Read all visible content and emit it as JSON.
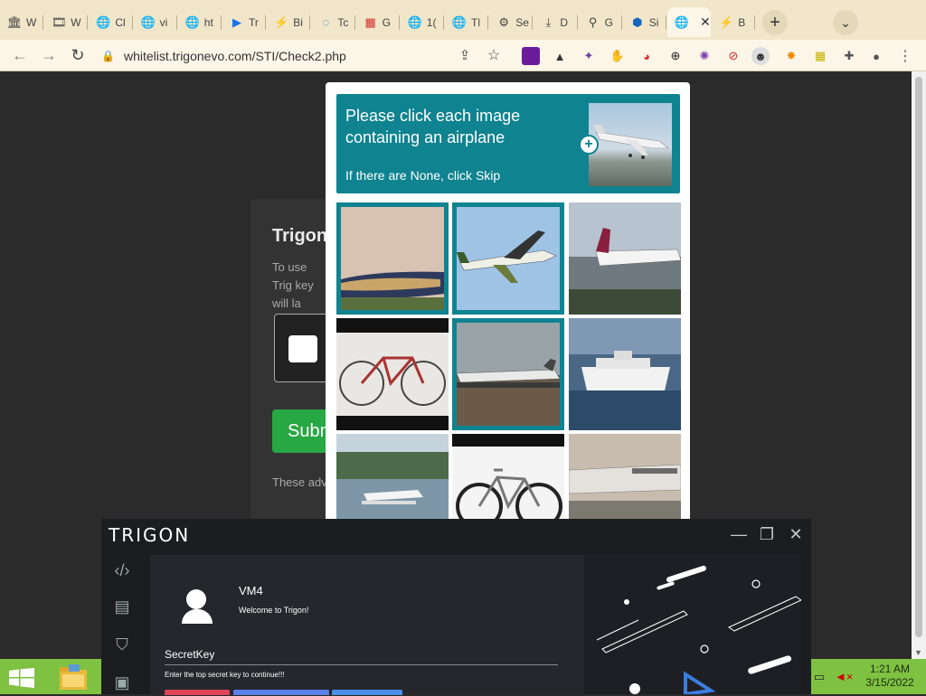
{
  "browser": {
    "tabs": [
      {
        "label": "W",
        "icon": "museum-icon"
      },
      {
        "label": "W",
        "icon": "film-icon"
      },
      {
        "label": "Cl",
        "icon": "globe-icon"
      },
      {
        "label": "vi",
        "icon": "globe-icon"
      },
      {
        "label": "ht",
        "icon": "globe-icon"
      },
      {
        "label": "Tr",
        "icon": "play-icon"
      },
      {
        "label": "Bi",
        "icon": "bolt-icon"
      },
      {
        "label": "Tc",
        "icon": "loading-icon"
      },
      {
        "label": "G",
        "icon": "red-grid-icon"
      },
      {
        "label": "1(",
        "icon": "globe-icon"
      },
      {
        "label": "Tl",
        "icon": "globe-icon"
      },
      {
        "label": "Se",
        "icon": "gear-icon"
      },
      {
        "label": "D",
        "icon": "download-icon"
      },
      {
        "label": "G",
        "icon": "pin-icon"
      },
      {
        "label": "Si",
        "icon": "cube-icon"
      },
      {
        "label": "",
        "icon": "globe-icon"
      },
      {
        "label": "B",
        "icon": "bolt-icon"
      }
    ],
    "new_tab": "+",
    "tab_search": "⌄",
    "url": "whitelist.trigonevo.com/STI/Check2.php"
  },
  "page": {
    "title": "Trigon",
    "desc": "To use Trig key will la",
    "submit": "Subm",
    "footer": "These adv"
  },
  "captcha": {
    "prompt": "Please click each image containing an airplane",
    "hint": "If there are None, click Skip",
    "accent": "#0f8390"
  },
  "trigon": {
    "logo": "TRIGON",
    "user": "VM4",
    "welcome": "Welcome to Trigon!",
    "key_label": "SecretKey",
    "key_hint": "Enter the top secret key to continue!!!"
  },
  "taskbar": {
    "time": "1:21 AM",
    "date": "3/15/2022"
  }
}
